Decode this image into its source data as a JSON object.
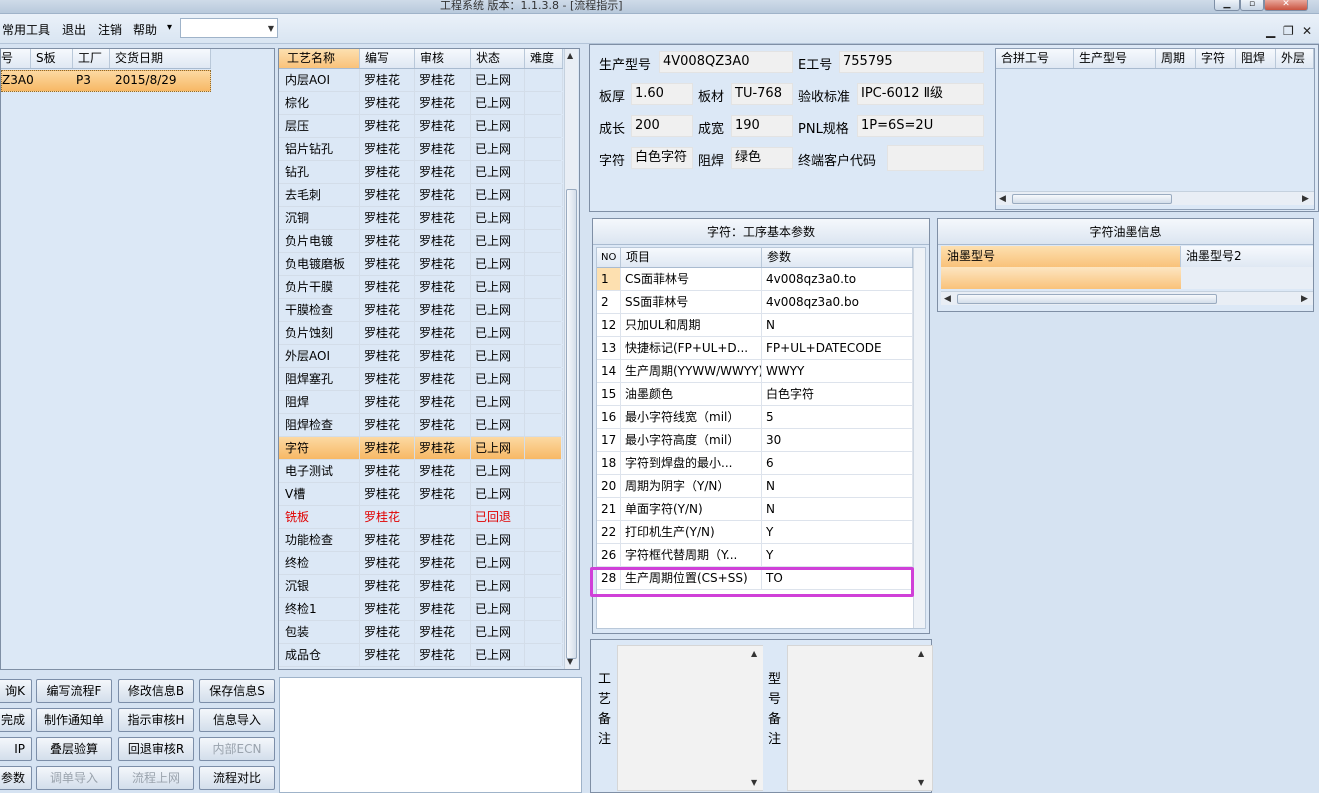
{
  "window": {
    "title": "工程系统  版本：1.1.3.8 - [流程指示]"
  },
  "menu": {
    "items": [
      "常用工具",
      "退出",
      "注销",
      "帮助"
    ],
    "help_arrow": "▾",
    "combo_value": ""
  },
  "order_grid": {
    "headers": [
      "号",
      "S板",
      "工厂",
      "交货日期"
    ],
    "row": {
      "no": "Z3A0",
      "s": "",
      "factory": "P3",
      "date": "2015/8/29"
    }
  },
  "process_grid": {
    "headers": [
      "工艺名称",
      "编写",
      "审核",
      "状态",
      "难度"
    ],
    "rows": [
      {
        "name": "内层AOI",
        "writer": "罗桂花",
        "reviewer": "罗桂花",
        "status": "已上网"
      },
      {
        "name": "棕化",
        "writer": "罗桂花",
        "reviewer": "罗桂花",
        "status": "已上网"
      },
      {
        "name": "层压",
        "writer": "罗桂花",
        "reviewer": "罗桂花",
        "status": "已上网"
      },
      {
        "name": "铝片钻孔",
        "writer": "罗桂花",
        "reviewer": "罗桂花",
        "status": "已上网"
      },
      {
        "name": "钻孔",
        "writer": "罗桂花",
        "reviewer": "罗桂花",
        "status": "已上网"
      },
      {
        "name": "去毛刺",
        "writer": "罗桂花",
        "reviewer": "罗桂花",
        "status": "已上网"
      },
      {
        "name": "沉铜",
        "writer": "罗桂花",
        "reviewer": "罗桂花",
        "status": "已上网"
      },
      {
        "name": "负片电镀",
        "writer": "罗桂花",
        "reviewer": "罗桂花",
        "status": "已上网"
      },
      {
        "name": "负电镀磨板",
        "writer": "罗桂花",
        "reviewer": "罗桂花",
        "status": "已上网"
      },
      {
        "name": "负片干膜",
        "writer": "罗桂花",
        "reviewer": "罗桂花",
        "status": "已上网"
      },
      {
        "name": "干膜检查",
        "writer": "罗桂花",
        "reviewer": "罗桂花",
        "status": "已上网"
      },
      {
        "name": "负片蚀刻",
        "writer": "罗桂花",
        "reviewer": "罗桂花",
        "status": "已上网"
      },
      {
        "name": "外层AOI",
        "writer": "罗桂花",
        "reviewer": "罗桂花",
        "status": "已上网"
      },
      {
        "name": "阻焊塞孔",
        "writer": "罗桂花",
        "reviewer": "罗桂花",
        "status": "已上网"
      },
      {
        "name": "阻焊",
        "writer": "罗桂花",
        "reviewer": "罗桂花",
        "status": "已上网"
      },
      {
        "name": "阻焊检查",
        "writer": "罗桂花",
        "reviewer": "罗桂花",
        "status": "已上网"
      },
      {
        "name": "字符",
        "writer": "罗桂花",
        "reviewer": "罗桂花",
        "status": "已上网"
      },
      {
        "name": "电子测试",
        "writer": "罗桂花",
        "reviewer": "罗桂花",
        "status": "已上网"
      },
      {
        "name": "V槽",
        "writer": "罗桂花",
        "reviewer": "罗桂花",
        "status": "已上网"
      },
      {
        "name": "铣板",
        "writer": "罗桂花",
        "reviewer": "",
        "status": "已回退"
      },
      {
        "name": "功能检查",
        "writer": "罗桂花",
        "reviewer": "罗桂花",
        "status": "已上网"
      },
      {
        "name": "终检",
        "writer": "罗桂花",
        "reviewer": "罗桂花",
        "status": "已上网"
      },
      {
        "name": "沉银",
        "writer": "罗桂花",
        "reviewer": "罗桂花",
        "status": "已上网"
      },
      {
        "name": "终检1",
        "writer": "罗桂花",
        "reviewer": "罗桂花",
        "status": "已上网"
      },
      {
        "name": "包装",
        "writer": "罗桂花",
        "reviewer": "罗桂花",
        "status": "已上网"
      },
      {
        "name": "成品仓",
        "writer": "罗桂花",
        "reviewer": "罗桂花",
        "status": "已上网"
      }
    ]
  },
  "buttons": [
    [
      "询K",
      "编写流程F",
      "修改信息B",
      "保存信息S"
    ],
    [
      "完成",
      "制作通知单",
      "指示审核H",
      "信息导入"
    ],
    [
      "IP",
      "叠层验算",
      "回退审核R",
      "内部ECN"
    ],
    [
      "参数",
      "调单导入",
      "流程上网",
      "流程对比"
    ]
  ],
  "product_info": {
    "model_label": "生产型号",
    "model_value": "4V008QZ3A0",
    "e_no_label": "E工号",
    "e_no_value": "755795",
    "thickness_label": "板厚",
    "thickness_value": "1.60",
    "material_label": "板材",
    "material_value": "TU-768",
    "standard_label": "验收标准",
    "standard_value": "IPC-6012 Ⅱ级",
    "length_label": "成长",
    "length_value": "200",
    "width_label": "成宽",
    "width_value": "190",
    "pnl_label": "PNL规格",
    "pnl_value": "1P=6S=2U",
    "legend_label": "字符",
    "legend_value": "白色字符",
    "solder_label": "阻焊",
    "solder_value": "绿色",
    "customer_label": "终端客户代码",
    "customer_value": ""
  },
  "merge_grid": {
    "headers": [
      "合拼工号",
      "生产型号",
      "周期",
      "字符",
      "阻焊",
      "外层"
    ]
  },
  "params_panel": {
    "title": "字符：工序基本参数",
    "headers": [
      "NO",
      "项目",
      "参数"
    ],
    "rows": [
      {
        "no": "1",
        "item": "CS面菲林号",
        "value": "4v008qz3a0.to"
      },
      {
        "no": "2",
        "item": "SS面菲林号",
        "value": "4v008qz3a0.bo"
      },
      {
        "no": "12",
        "item": "只加UL和周期",
        "value": "N"
      },
      {
        "no": "13",
        "item": "快捷标记(FP+UL+D...",
        "value": "FP+UL+DATECODE"
      },
      {
        "no": "14",
        "item": "生产周期(YYWW/WWYY)",
        "value": "WWYY"
      },
      {
        "no": "15",
        "item": "油墨颜色",
        "value": "白色字符"
      },
      {
        "no": "16",
        "item": "最小字符线宽（mil）",
        "value": "5"
      },
      {
        "no": "17",
        "item": "最小字符高度（mil）",
        "value": "30"
      },
      {
        "no": "18",
        "item": "字符到焊盘的最小...",
        "value": "6"
      },
      {
        "no": "20",
        "item": "周期为阴字（Y/N）",
        "value": "N"
      },
      {
        "no": "21",
        "item": "单面字符(Y/N)",
        "value": "N"
      },
      {
        "no": "22",
        "item": "打印机生产(Y/N)",
        "value": "Y"
      },
      {
        "no": "26",
        "item": "字符框代替周期（Y...",
        "value": "Y"
      },
      {
        "no": "28",
        "item": "生产周期位置(CS+SS)",
        "value": "TO"
      }
    ],
    "highlight_color": "#d040d8"
  },
  "ink_panel": {
    "title": "字符油墨信息",
    "headers": [
      "油墨型号",
      "油墨型号2"
    ]
  },
  "remarks": {
    "process_label": "工艺备注",
    "model_label": "型号备注"
  }
}
